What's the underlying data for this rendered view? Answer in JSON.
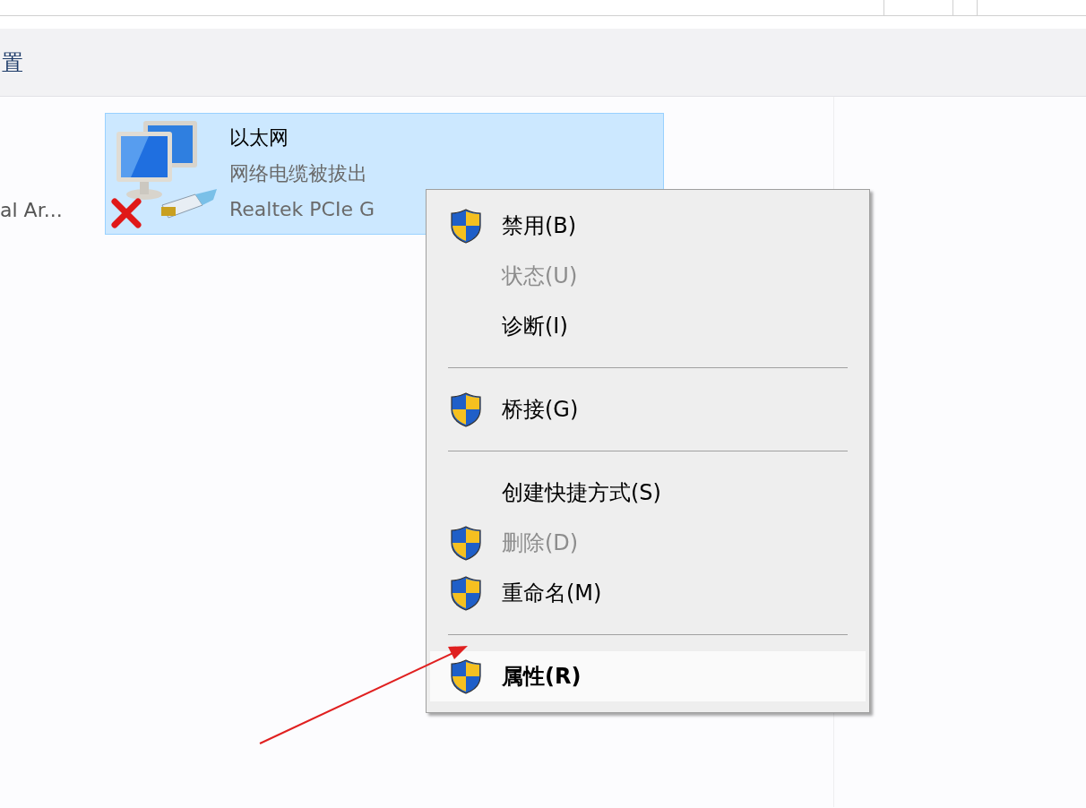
{
  "toolbar": {
    "title": "置"
  },
  "left_item": {
    "label": "al Ar..."
  },
  "adapter": {
    "name": "以太网",
    "status": "网络电缆被拔出",
    "device": "Realtek PCIe G",
    "selected": true,
    "disconnected": true
  },
  "context_menu": {
    "items": [
      {
        "kind": "item",
        "label": "禁用(B)",
        "shield": true,
        "disabled": false,
        "selected": false,
        "default": false
      },
      {
        "kind": "item",
        "label": "状态(U)",
        "shield": false,
        "disabled": true,
        "selected": false,
        "default": false
      },
      {
        "kind": "item",
        "label": "诊断(I)",
        "shield": false,
        "disabled": false,
        "selected": false,
        "default": false
      },
      {
        "kind": "separator"
      },
      {
        "kind": "item",
        "label": "桥接(G)",
        "shield": true,
        "disabled": false,
        "selected": false,
        "default": false
      },
      {
        "kind": "separator"
      },
      {
        "kind": "item",
        "label": "创建快捷方式(S)",
        "shield": false,
        "disabled": false,
        "selected": false,
        "default": false
      },
      {
        "kind": "item",
        "label": "删除(D)",
        "shield": true,
        "disabled": true,
        "selected": false,
        "default": false
      },
      {
        "kind": "item",
        "label": "重命名(M)",
        "shield": true,
        "disabled": false,
        "selected": false,
        "default": false
      },
      {
        "kind": "separator"
      },
      {
        "kind": "item",
        "label": "属性(R)",
        "shield": true,
        "disabled": false,
        "selected": true,
        "default": true
      }
    ]
  }
}
